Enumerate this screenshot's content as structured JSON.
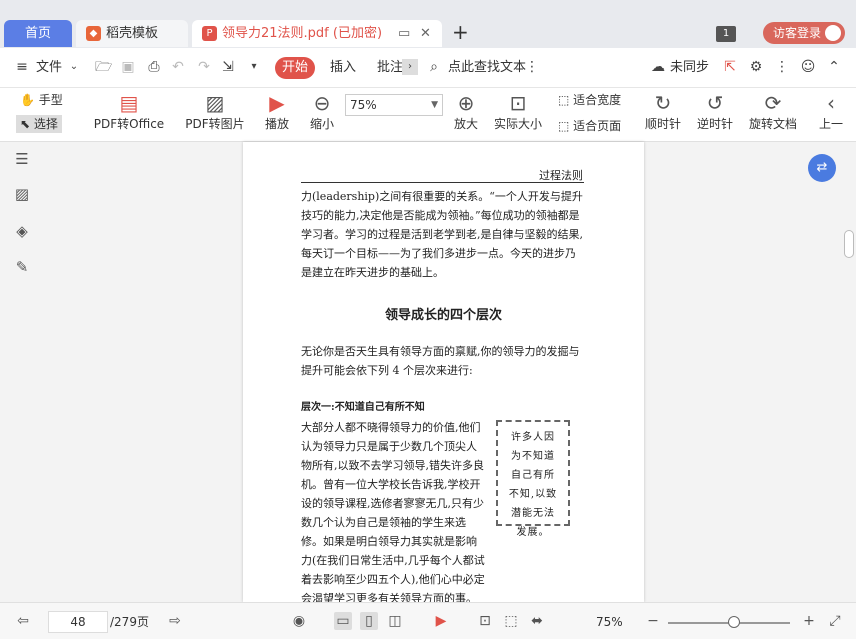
{
  "tabs": {
    "home": "首页",
    "template": "稻壳模板",
    "doc_title": "领导力21法则.pdf (已加密)",
    "add": "+"
  },
  "window": {
    "page_count_badge": "1",
    "login": "访客登录"
  },
  "menu": {
    "file": "文件",
    "start": "开始",
    "insert": "插入",
    "annotate": "批注",
    "search": "点此查找文本",
    "sync": "未同步"
  },
  "toolbar": {
    "hand": "手型",
    "select": "选择",
    "pdf_to_office": "PDF转Office",
    "pdf_to_image": "PDF转图片",
    "play": "播放",
    "zoom_out": "缩小",
    "zoom_value": "75%",
    "zoom_in": "放大",
    "actual_size": "实际大小",
    "fit_width": "适合宽度",
    "fit_page": "适合页面",
    "rotate_cw": "顺时针",
    "rotate_ccw": "逆时针",
    "rotate_doc": "旋转文档",
    "prev": "上一"
  },
  "document": {
    "running_header": "过程法则",
    "para1": "力(leadership)之间有很重要的关系。“一个人开发与提升技巧的能力,决定他是否能成为领袖。”每位成功的领袖都是学习者。学习的过程是活到老学到老,是自律与坚毅的结果,每天订一个目标——为了我们多进步一点。今天的进步乃是建立在昨天进步的基础上。",
    "heading": "领导成长的四个层次",
    "para2": "无论你是否天生具有领导方面的禀赋,你的领导力的发掘与提升可能会依下列 4 个层次来进行:",
    "subheading": "层次一:不知道自己有所不知",
    "para3": "大部分人都不晓得领导力的价值,他们认为领导力只是属于少数几个顶尖人物所有,以致不去学习领导,错失许多良机。曾有一位大学校长告诉我,学校开设的领导课程,选修者寥寥无几,只有少数几个认为自己是领袖的学生来选修。如果是明白领导力其实就是影响力(在我们日常生活中,几乎每个人都试着去影响至少四五个人),他们心中必定会渴望学习更多有关领导方面的事。不幸的是,许多人因为不知道自己有所不知,以致潜能无法发展。",
    "quote": "许多人因为不知道自己有所不知,以致潜能无法发展。"
  },
  "status": {
    "current_page": "48",
    "total_pages": "/279页",
    "zoom": "75%",
    "minus": "−",
    "plus": "+"
  }
}
